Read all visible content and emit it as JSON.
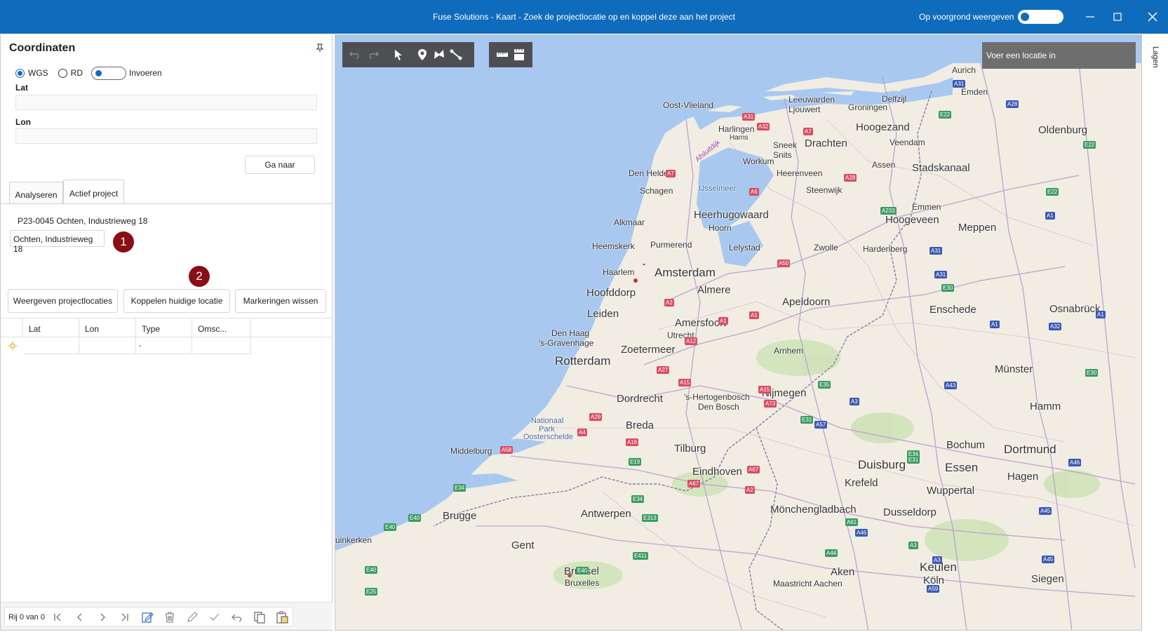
{
  "window": {
    "title": "Fuse Solutions - Kaart - Zoek de projectlocatie op en koppel deze aan het project",
    "foreground_label": "Op voorgrond weergeven",
    "accent": "#0f6cbd"
  },
  "panel": {
    "title": "Coordinaten",
    "coord_system": {
      "wgs": "WGS",
      "rd": "RD",
      "selected": "WGS"
    },
    "input_toggle_label": "Invoeren",
    "lat_label": "Lat",
    "lat_value": "",
    "lon_label": "Lon",
    "lon_value": "",
    "goto_label": "Ga naar",
    "tabs": [
      "Analyseren",
      "Actief project"
    ],
    "active_tab": "Actief project",
    "project_code": "P23-0045 Ochten, Industrieweg 18",
    "address": "Ochten, Industrieweg 18",
    "badge1": "1",
    "badge2": "2",
    "buttons": {
      "show": "Weergeven projectlocaties",
      "link": "Koppelen huidige locatie",
      "clear": "Markeringen wissen"
    },
    "grid": {
      "headers": [
        "Lat",
        "Lon",
        "Type",
        "Omsc..."
      ],
      "row": [
        "",
        "",
        "-",
        ""
      ]
    },
    "pager_text": "Rij 0 van 0"
  },
  "map": {
    "search_placeholder": "Voer een locatie in",
    "layers_label": "Lagen",
    "water_color": "#a8c8f0",
    "cities": {
      "aurich": "Aurich",
      "emden": "Emden",
      "delfzijl": "Delfzijl",
      "oost_vlieland": "Oost-Vlieland",
      "leeuwarden": "Leeuwarden",
      "ljouwert": "Ljouwert",
      "groningen": "Groningen",
      "harlingen": "Harlingen",
      "harns": "Harns",
      "hoogezand": "Hoogezand",
      "oldenburg": "Oldenburg",
      "sneek": "Sneek",
      "snits": "Snits",
      "drachten": "Drachten",
      "veendam": "Veendam",
      "afsluitdijk": "Afsluitdijk",
      "workum": "Workum",
      "assen": "Assen",
      "stadskanaal": "Stadskanaal",
      "den_helder": "Den Helder",
      "heerenveen": "Heerenveen",
      "schagen": "Schagen",
      "ijsselmeer": "IJsselmeer",
      "steenwijk": "Steenwijk",
      "emmen": "Emmen",
      "heerhugowaard": "Heerhugowaard",
      "alkmaar": "Alkmaar",
      "hoorn": "Hoorn",
      "hoogeveen": "Hoogeveen",
      "meppen": "Meppen",
      "heemskerk": "Heemskerk",
      "purmerend": "Purmerend",
      "lelystad": "Lelystad",
      "zwolle": "Zwolle",
      "hardenberg": "Hardenberg",
      "haarlem": "Haarlem",
      "amsterdam": "Amsterdam",
      "hoofddorp": "Hoofddorp",
      "almere": "Almere",
      "apeldoorn": "Apeldoorn",
      "enschede": "Enschede",
      "osnabruck": "Osnabrück",
      "leiden": "Leiden",
      "amersfoort": "Amersfoort",
      "den_haag": "Den Haag",
      "s_gravenhage": "'s-Gravenhage",
      "utrecht": "Utrecht",
      "zoetermeer": "Zoetermeer",
      "arnhem": "Arnhem",
      "rotterdam": "Rotterdam",
      "munster": "Münster",
      "nijmegen": "Nijmegen",
      "s_hertogenbosch": "'s-Hertogenbosch",
      "den_bosch": "Den Bosch",
      "dordrecht": "Dordrecht",
      "hamm": "Hamm",
      "nationaal_park": "Nationaal",
      "park": "Park",
      "oosterschelde": "Oosterschelde",
      "breda": "Breda",
      "middelburg": "Middelburg",
      "tilburg": "Tilburg",
      "bochum": "Bochum",
      "dortmund": "Dortmund",
      "duisburg": "Duisburg",
      "essen": "Essen",
      "eindhoven": "Eindhoven",
      "krefeld": "Krefeld",
      "hagen": "Hagen",
      "wuppertal": "Wuppertal",
      "monchengladbach": "Mönchengladbach",
      "brugge": "Brugge",
      "antwerpen": "Antwerpen",
      "dusseldorp": "Dusseldorp",
      "uinkerken": "uinkerken",
      "gent": "Gent",
      "brussel": "Brussel",
      "bruxelles": "Bruxelles",
      "aken": "Aken",
      "maastricht_aachen": "Maastricht Aachen",
      "keulen": "Keulen",
      "koln": "Köln",
      "siegen": "Siegen"
    },
    "highways": {
      "a31": "A31",
      "a28": "A28",
      "a32": "A32",
      "a7": "A7",
      "e22": "E22",
      "a6": "A6",
      "a37": "A37",
      "a1": "A1",
      "a9": "A9",
      "a50": "A50",
      "a2": "A2",
      "a12": "A12",
      "a27": "A27",
      "a15": "A15",
      "a16": "A16",
      "a58": "A58",
      "a4": "A4",
      "a29": "A29",
      "a67": "A67",
      "a3": "A3",
      "a30": "A30",
      "a73": "A73",
      "e35": "E35",
      "e31": "E31",
      "e34": "E34",
      "e40": "E40",
      "e19": "E19",
      "e313": "E313",
      "e25": "E25",
      "e411": "E411",
      "a57": "A57",
      "a43": "A43",
      "a46": "A46",
      "a45": "A45",
      "a44": "A44",
      "a61": "A61",
      "a59": "A59",
      "a233": "A233",
      "e30": "E30"
    }
  }
}
